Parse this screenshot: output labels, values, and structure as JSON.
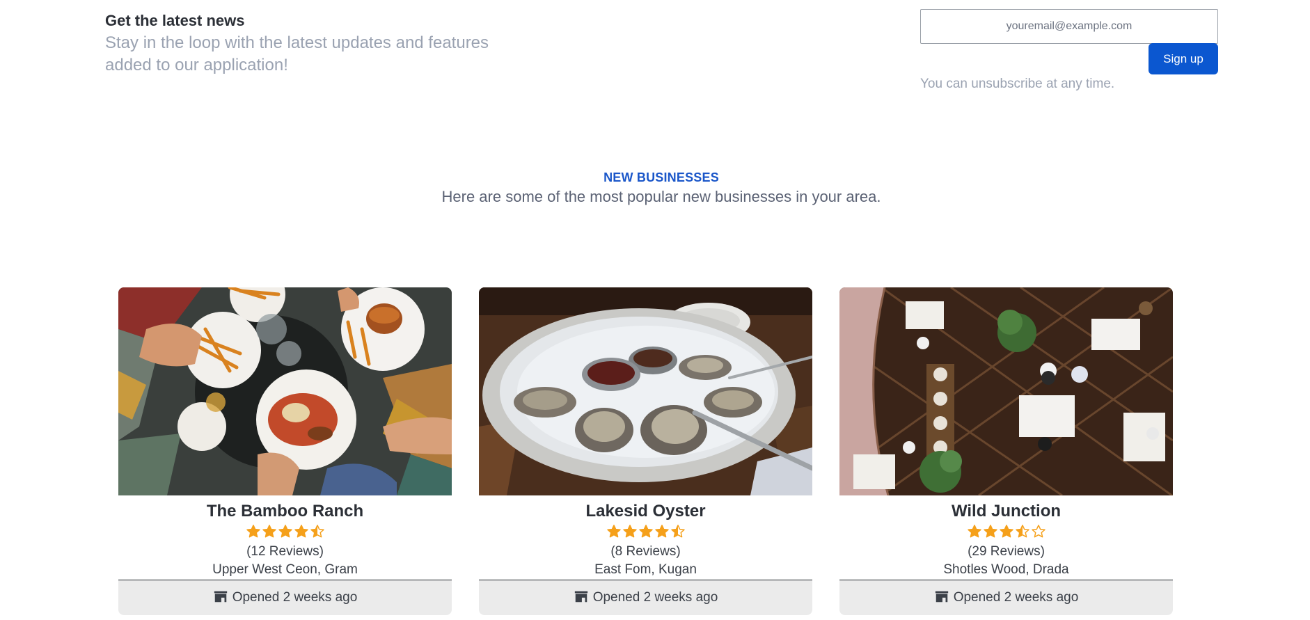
{
  "newsletter": {
    "title": "Get the latest news",
    "subtitle": "Stay in the loop with the latest updates and features added to our application!",
    "email_placeholder": "youremail@example.com",
    "signup_label": "Sign up",
    "unsubscribe_note": "You can unsubscribe at any time."
  },
  "section": {
    "eyebrow": "NEW BUSINESSES",
    "lead": "Here are some of the most popular new businesses in your area."
  },
  "colors": {
    "accent": "#0b57d0",
    "star": "#f5a01a",
    "muted_text": "#9aa2b1",
    "footer_bg": "#ebebeb"
  },
  "icons": {
    "rating": "star-icon",
    "opened": "store-icon"
  },
  "businesses": [
    {
      "name": "The Bamboo Ranch",
      "rating": 4.5,
      "reviews": "(12 Reviews)",
      "location": "Upper West Ceon, Gram",
      "opened": "Opened 2 weeks ago"
    },
    {
      "name": "Lakesid Oyster",
      "rating": 4.5,
      "reviews": "(8 Reviews)",
      "location": "East Fom, Kugan",
      "opened": "Opened 2 weeks ago"
    },
    {
      "name": "Wild Junction",
      "rating": 3.5,
      "reviews": "(29 Reviews)",
      "location": "Shotles Wood, Drada",
      "opened": "Opened 2 weeks ago"
    }
  ]
}
